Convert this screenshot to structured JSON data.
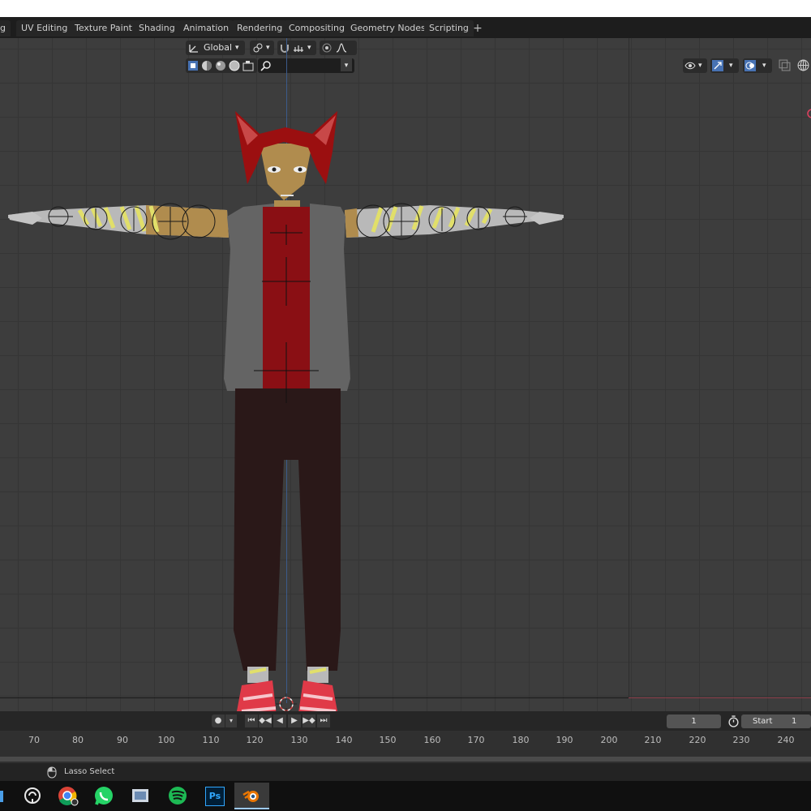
{
  "workspace_tabs": [
    {
      "label": "g"
    },
    {
      "label": "UV Editing"
    },
    {
      "label": "Texture Paint"
    },
    {
      "label": "Shading"
    },
    {
      "label": "Animation"
    },
    {
      "label": "Rendering"
    },
    {
      "label": "Compositing"
    },
    {
      "label": "Geometry Nodes"
    },
    {
      "label": "Scripting"
    }
  ],
  "add_workspace": "+",
  "viewport_header": {
    "orientation": "Global",
    "search_placeholder": ""
  },
  "timeline": {
    "current_frame": "1",
    "start_label": "Start",
    "start_value": "1",
    "ruler_ticks": [
      "70",
      "80",
      "90",
      "100",
      "110",
      "120",
      "130",
      "140",
      "150",
      "160",
      "170",
      "180",
      "190",
      "200",
      "210",
      "220",
      "230",
      "240"
    ]
  },
  "status": {
    "mouse_action": "Lasso Select"
  },
  "taskbar": {
    "ps_label": "Ps",
    "apps": [
      "chrome-icon",
      "whatsapp-icon",
      "files-icon",
      "spotify-icon",
      "photoshop-icon",
      "blender-icon"
    ]
  },
  "colors": {
    "hair": "#9b0f10",
    "shirt": "#8a0f14",
    "vest": "#646464",
    "pants": "#2a1818",
    "skin": "#b08c4e",
    "stripe_yellow": "#e1df6a",
    "shoe": "#e03a48"
  }
}
